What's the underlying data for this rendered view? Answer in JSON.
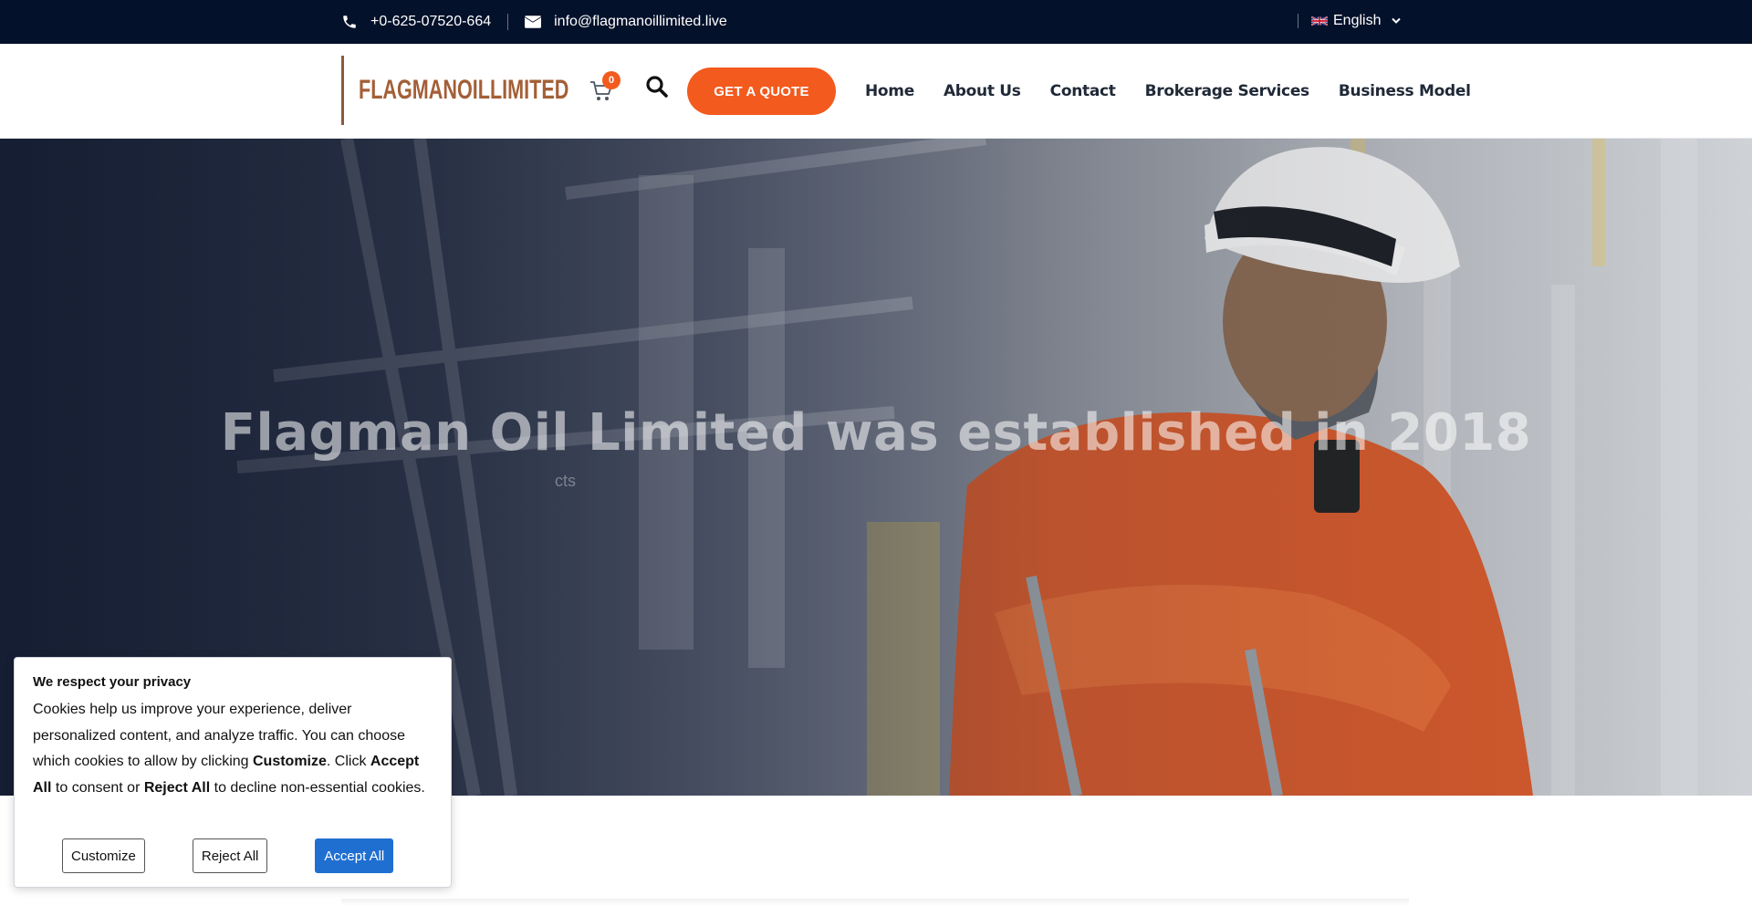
{
  "topbar": {
    "phone": "+0-625-07520-664",
    "email": "info@flagmanoillimited.live",
    "language": "English"
  },
  "header": {
    "logo_text": "FLAGMANOILLIMITED",
    "cart_count": "0",
    "quote_button": "GET A QUOTE",
    "nav": [
      "Home",
      "About Us",
      "Contact",
      "Brokerage Services",
      "Business Model"
    ]
  },
  "hero": {
    "headline": "Flagman Oil Limited was established in 2018",
    "subtext": "cts"
  },
  "cookie": {
    "title": "We respect your privacy",
    "text_1": "Cookies help us improve your experience, deliver personalized content, and analyze traffic. You can choose which cookies to allow by clicking ",
    "bold_customize": "Customize",
    "text_2": ". Click ",
    "bold_accept": "Accept All",
    "text_3": " to consent or ",
    "bold_reject": "Reject All",
    "text_4": " to decline non-essential cookies.",
    "buttons": {
      "customize": "Customize",
      "reject": "Reject All",
      "accept": "Accept All"
    }
  },
  "colors": {
    "topbar_bg": "#04112a",
    "accent": "#f35a1e",
    "logo": "#a35f37",
    "accept_button": "#1f6fd1"
  },
  "icons": [
    "phone-icon",
    "envelope-icon",
    "uk-flag-icon",
    "chevron-down-icon",
    "cart-icon",
    "search-icon"
  ]
}
